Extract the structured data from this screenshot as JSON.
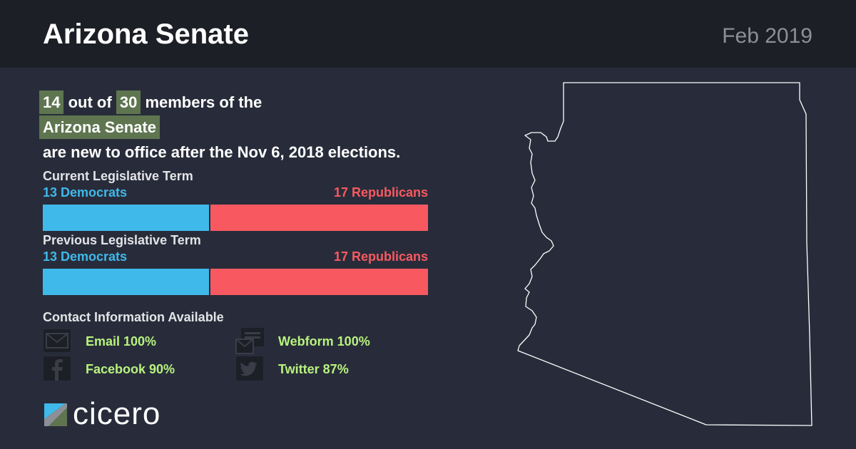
{
  "header": {
    "title": "Arizona Senate",
    "date": "Feb 2019"
  },
  "headline": {
    "new_count": "14",
    "out_of": "out of",
    "total": "30",
    "members_of_the": "members of the",
    "chamber": "Arizona Senate",
    "rest": "are new to office after the Nov 6, 2018 elections."
  },
  "current_term": {
    "label": "Current Legislative Term",
    "dem_label": "13 Democrats",
    "rep_label": "17 Republicans",
    "dem": 13,
    "rep": 17
  },
  "previous_term": {
    "label": "Previous Legislative Term",
    "dem_label": "13 Democrats",
    "rep_label": "17 Republicans",
    "dem": 13,
    "rep": 17
  },
  "contact": {
    "title": "Contact Information Available",
    "email": "Email 100%",
    "webform": "Webform 100%",
    "facebook": "Facebook 90%",
    "twitter": "Twitter 87%"
  },
  "logo": {
    "word": "cicero"
  },
  "colors": {
    "democrat": "#3fb9ea",
    "republican": "#f85960",
    "highlight": "#5e7550",
    "contact_text": "#b8f27f",
    "background": "#282c3a",
    "header_bg": "#1d1f27"
  }
}
